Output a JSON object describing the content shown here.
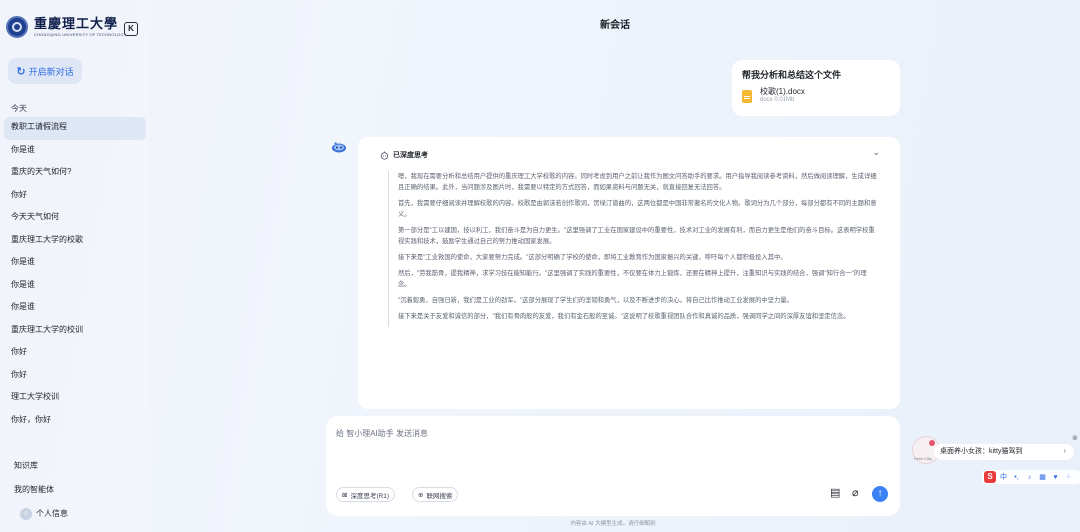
{
  "sidebar": {
    "logo_cn": "重慶理工大學",
    "logo_en": "CHONGQING UNIVERSITY OF TECHNOLOGY",
    "new_chat_label": "开启新对话",
    "group_today": "今天",
    "history": [
      "教职工请假流程",
      "你是谁",
      "重庆的天气如何?",
      "你好",
      "今天天气如何",
      "重庆理工大学的校歌",
      "你是谁",
      "你是谁",
      "你是谁",
      "重庆理工大学的校训",
      "你好",
      "你好",
      "理工大学校训",
      "你好，你好"
    ],
    "knowledge_base": "知识库",
    "my_agent": "我的智能体",
    "profile": "个人信息"
  },
  "header": {
    "title": "新会话"
  },
  "user_message": {
    "text": "帮我分析和总结这个文件",
    "file_name": "校歌(1).docx",
    "file_meta": "docx  0.01Mb"
  },
  "thinking": {
    "label": "已深度思考",
    "paragraphs": [
      "嗯，我现在需要分析和总结用户提供的重庆理工大学校歌的内容。同时考虑到用户之前让我作为图文问答助手的要求。用户指导我阅读参考资料，然后做阅读理解，生成详细且正确的结果。此外，当问题涉及图片时，我需要以特定的方式回答，而如果资料与问题无关，就直接回复无法回答。",
      "首先，我需要仔细阅读并理解校歌的内容。校歌是由郭沫若创作歌词，贺绿汀谱曲的，这两位都是中国非常著名的文化人物。歌词分为几个部分，每部分都有不同的主题和意义。",
      "第一部分是\"工以建国，技以利工，我们奋斗是为自力更生。\"这里强调了工业在国家建设中的重要性，技术对工业的发展有利，而自力更生是他们的奋斗目标。这表明学校重视实践和技术，鼓励学生通过自己的努力推动国家发展。",
      "接下来是\"工业救国的使命，大家要努力完成。\"这部分明确了学校的使命，即将工业教育作为国家振兴的关键，呼吁每个人都积极投入其中。",
      "然后，\"劳我筋骨，提我精神，求学习技在能知能行。\"这里强调了实践的重要性，不仅要在体力上锻炼，还要在精神上提升，注重知识与实践的结合，强调\"知行合一\"的理念。",
      "\"沉着毅勇，自强日新，我们是工业的劲军。\"这部分展现了学生们的坚韧和勇气，以及不断进步的决心。将自己比作推动工业发展的中坚力量。",
      "接下来是关于友爱和诚信的部分，\"我们有骨肉般的友爱，我们有金石般的至诚。\"这说明了校歌重视团队合作和真诚的品质，强调同学之间的深厚友谊和坚定信念。"
    ]
  },
  "input": {
    "placeholder": "给 智小理AI助手 发送消息",
    "deep_think_label": "深度思考(R1)",
    "web_search_label": "联网搜索"
  },
  "footer_note": "内容由 AI 大模型生成，请仔细甄别",
  "desktop": {
    "kitty_label": "Hello Kitty",
    "kitty_text": "桌面养小女孩：kitty猫驾到",
    "ime_char": "中"
  },
  "colors": {
    "accent": "#2f6de5",
    "send_button": "#3b82f6",
    "file_icon": "#f5b831"
  }
}
